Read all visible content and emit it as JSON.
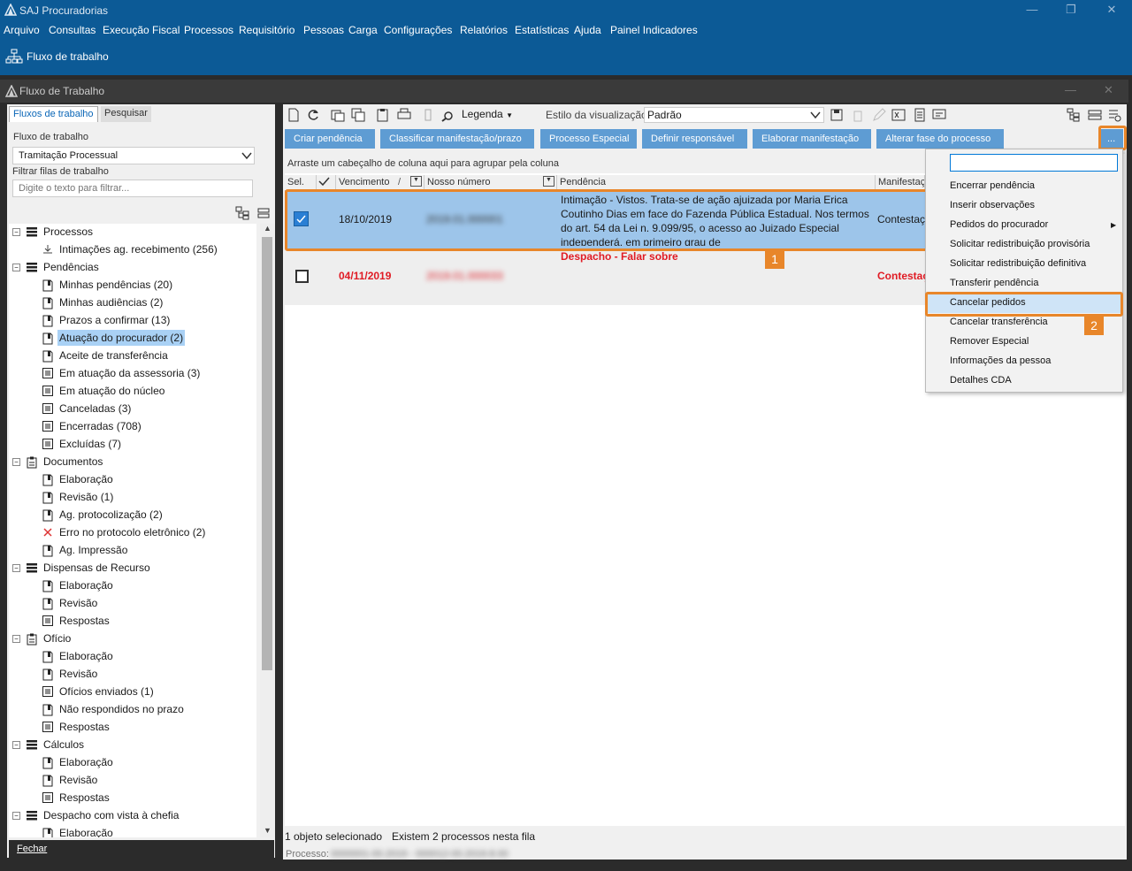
{
  "app": {
    "title": "SAJ Procuradorias"
  },
  "menu": [
    "Arquivo",
    "Consultas",
    "Execução Fiscal",
    "Processos",
    "Requisitório",
    "Pessoas",
    "Carga",
    "Configurações",
    "Relatórios",
    "Estatísticas",
    "Ajuda",
    "Painel Indicadores"
  ],
  "quickbar": {
    "fluxo_label": "Fluxo de trabalho"
  },
  "window": {
    "title": "Fluxo de Trabalho"
  },
  "left": {
    "tabs": [
      "Fluxos de trabalho",
      "Pesquisar"
    ],
    "fluxo_label": "Fluxo de trabalho",
    "fluxo_value": "Tramitação Processual",
    "filter_label": "Filtrar filas de trabalho",
    "filter_placeholder": "Digite o texto para filtrar...",
    "close": "Fechar",
    "tree": [
      {
        "label": "Processos",
        "level": 0,
        "icon": "stack-icon"
      },
      {
        "label": "Intimações ag. recebimento (256)",
        "level": 1,
        "icon": "download-icon"
      },
      {
        "label": "Pendências",
        "level": 0,
        "icon": "stack-icon"
      },
      {
        "label": "Minhas pendências (20)",
        "level": 1,
        "icon": "document-icon"
      },
      {
        "label": "Minhas audiências (2)",
        "level": 1,
        "icon": "document-icon"
      },
      {
        "label": "Prazos a confirmar (13)",
        "level": 1,
        "icon": "document-icon"
      },
      {
        "label": "Atuação do procurador (2)",
        "level": 1,
        "icon": "document-icon",
        "selected": true
      },
      {
        "label": "Aceite de transferência",
        "level": 1,
        "icon": "document-icon"
      },
      {
        "label": "Em atuação da assessoria (3)",
        "level": 1,
        "icon": "list-icon"
      },
      {
        "label": "Em atuação do núcleo",
        "level": 1,
        "icon": "list-icon"
      },
      {
        "label": "Canceladas (3)",
        "level": 1,
        "icon": "list-icon"
      },
      {
        "label": "Encerradas (708)",
        "level": 1,
        "icon": "list-icon"
      },
      {
        "label": "Excluídas (7)",
        "level": 1,
        "icon": "list-icon"
      },
      {
        "label": "Documentos",
        "level": 0,
        "icon": "clipboard-icon"
      },
      {
        "label": "Elaboração",
        "level": 1,
        "icon": "document-icon"
      },
      {
        "label": "Revisão (1)",
        "level": 1,
        "icon": "document-icon"
      },
      {
        "label": "Ag. protocolização (2)",
        "level": 1,
        "icon": "document-icon"
      },
      {
        "label": "Erro no protocolo eletrônico (2)",
        "level": 1,
        "icon": "x-icon"
      },
      {
        "label": "Ag. Impressão",
        "level": 1,
        "icon": "document-icon"
      },
      {
        "label": "Dispensas de Recurso",
        "level": 0,
        "icon": "stack-icon"
      },
      {
        "label": "Elaboração",
        "level": 1,
        "icon": "document-icon"
      },
      {
        "label": "Revisão",
        "level": 1,
        "icon": "document-icon"
      },
      {
        "label": "Respostas",
        "level": 1,
        "icon": "list-icon"
      },
      {
        "label": "Ofício",
        "level": 0,
        "icon": "clipboard-icon"
      },
      {
        "label": "Elaboração",
        "level": 1,
        "icon": "document-icon"
      },
      {
        "label": "Revisão",
        "level": 1,
        "icon": "document-icon"
      },
      {
        "label": "Ofícios enviados (1)",
        "level": 1,
        "icon": "list-icon"
      },
      {
        "label": "Não respondidos no prazo",
        "level": 1,
        "icon": "document-icon"
      },
      {
        "label": "Respostas",
        "level": 1,
        "icon": "list-icon"
      },
      {
        "label": "Cálculos",
        "level": 0,
        "icon": "stack-icon"
      },
      {
        "label": "Elaboração",
        "level": 1,
        "icon": "document-icon"
      },
      {
        "label": "Revisão",
        "level": 1,
        "icon": "document-icon"
      },
      {
        "label": "Respostas",
        "level": 1,
        "icon": "list-icon"
      },
      {
        "label": "Despacho com vista à chefia",
        "level": 0,
        "icon": "stack-icon"
      },
      {
        "label": "Elaboração",
        "level": 1,
        "icon": "document-icon"
      }
    ]
  },
  "toolbar": {
    "legend": "Legenda",
    "view_style_label": "Estilo da visualização",
    "view_style_value": "Padrão"
  },
  "actions": [
    "Criar pendência",
    "Classificar manifestação/prazo",
    "Processo Especial",
    "Definir responsável",
    "Elaborar manifestação",
    "Alterar fase do processo"
  ],
  "more_button": "...",
  "grid": {
    "group_hint": "Arraste um cabeçalho de coluna aqui para agrupar pela coluna",
    "headers": [
      "Sel.",
      "Vencimento",
      "Nosso número",
      "Pendência",
      "Manifestação"
    ],
    "rows": [
      {
        "due": "18/10/2019",
        "number": "2019.01.000001",
        "pendencia": "Intimação - Vistos. Trata-se de ação ajuizada por Maria Erica Coutinho Dias em face do Fazenda Pública Estadual. Nos termos do art. 54 da Lei n. 9.099/95, o acesso ao Juizado Especial independerá, em primeiro grau de",
        "manifestacao": "Contestação",
        "checked": true
      },
      {
        "due": "04/11/2019",
        "number": "2019.01.000033",
        "pendencia": "Despacho - Falar sobre",
        "manifestacao": "Contestação",
        "checked": false
      }
    ]
  },
  "dropdown_items": [
    "Encerrar pendência",
    "Inserir observações",
    "Pedidos do procurador",
    "Solicitar redistribuição provisória",
    "Solicitar redistribuição definitiva",
    "Transferir pendência",
    "Cancelar pedidos",
    "Cancelar transferência",
    "Remover Especial",
    "Informações da pessoa",
    "Detalhes CDA"
  ],
  "callouts": [
    "1",
    "2"
  ],
  "status": {
    "selected": "1 objeto selecionado",
    "count": "Existem 2 processos nesta fila",
    "processo_label": "Processo:",
    "processo_value": "0000001-00.2019 - 000012-00.2019.8.00"
  }
}
